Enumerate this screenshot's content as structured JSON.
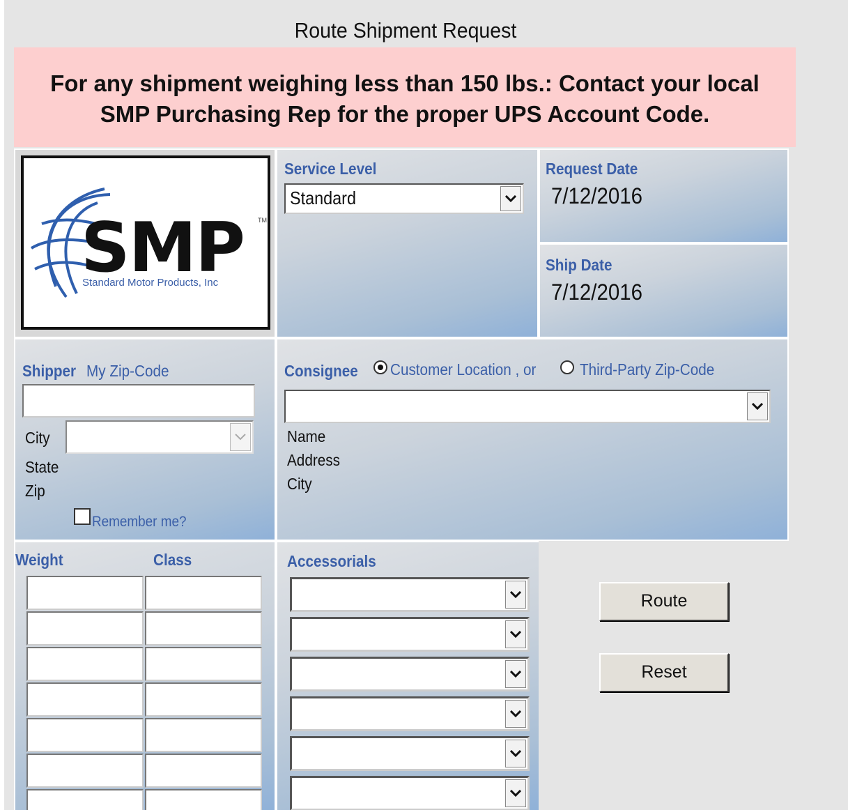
{
  "page": {
    "title": "Route Shipment Request",
    "notice_line1": "For any shipment weighing less than 150 lbs.: Contact your local",
    "notice_line2": "SMP Purchasing Rep for the proper UPS Account Code."
  },
  "logo": {
    "word": "SMP",
    "trademark": "TM",
    "subtitle": "Standard Motor Products, Inc"
  },
  "service": {
    "label": "Service Level",
    "selected": "Standard"
  },
  "dates": {
    "request_label": "Request Date",
    "request_value": "7/12/2016",
    "ship_label": "Ship Date",
    "ship_value": "7/12/2016"
  },
  "shipper": {
    "label": "Shipper",
    "zip_label": "My Zip-Code",
    "zip_value": "",
    "city_label": "City",
    "city_value": "",
    "state_label": "State",
    "zip_field_label": "Zip",
    "remember_label": "Remember me?",
    "remember_checked": false
  },
  "consignee": {
    "label": "Consignee",
    "option1": "Customer Location , or",
    "option2": "Third-Party Zip-Code",
    "selected_option": "Customer Location",
    "selected_value": "",
    "name_label": "Name",
    "address_label": "Address",
    "city_label": "City"
  },
  "freight": {
    "weight_label": "Weight",
    "class_label": "Class",
    "rows": [
      {
        "weight": "",
        "class": ""
      },
      {
        "weight": "",
        "class": ""
      },
      {
        "weight": "",
        "class": ""
      },
      {
        "weight": "",
        "class": ""
      },
      {
        "weight": "",
        "class": ""
      },
      {
        "weight": "",
        "class": ""
      },
      {
        "weight": "",
        "class": ""
      }
    ]
  },
  "accessorials": {
    "label": "Accessorials",
    "selects": [
      "",
      "",
      "",
      "",
      "",
      ""
    ]
  },
  "actions": {
    "route_label": "Route",
    "reset_label": "Reset"
  },
  "colors": {
    "notice_bg": "#fdcfcf",
    "label_blue": "#3b5fa8",
    "page_bg": "#e5e5e5"
  }
}
